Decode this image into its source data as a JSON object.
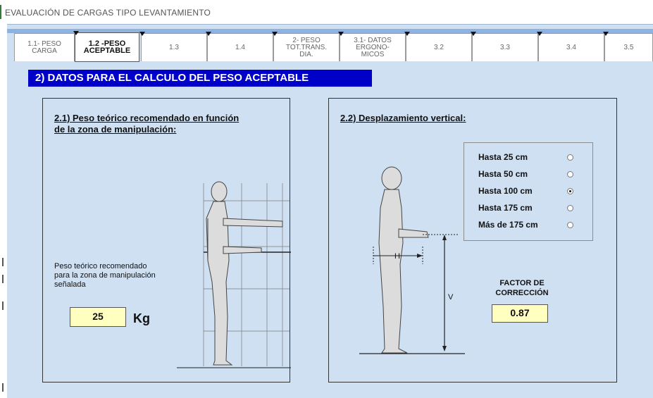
{
  "window": {
    "title": "EVALUACIÓN DE CARGAS TIPO LEVANTAMIENTO"
  },
  "tabs": [
    {
      "label": "1.1- PESO\nCARGA",
      "active": false
    },
    {
      "label": "1.2 -PESO\nACEPTABLE",
      "active": true
    },
    {
      "label": "1.3",
      "active": false
    },
    {
      "label": "1.4",
      "active": false
    },
    {
      "label": "2- PESO\nTOT.TRANS.\nDIA.",
      "active": false
    },
    {
      "label": "3.1- DATOS\nERGONO-\nMICOS",
      "active": false
    },
    {
      "label": "3.2",
      "active": false
    },
    {
      "label": "3.3",
      "active": false
    },
    {
      "label": "3.4",
      "active": false
    },
    {
      "label": "3.5",
      "active": false
    }
  ],
  "section": {
    "header": "2)  DATOS PARA EL CALCULO DEL PESO ACEPTABLE"
  },
  "panel_left": {
    "title_line1": "2.1) Peso teórico recomendado en función",
    "title_line2": "de la zona de manipulación:",
    "desc_line1": "Peso teórico recomendado",
    "desc_line2": "para la zona de manipulación",
    "desc_line3": "señalada",
    "weight_value": "25",
    "weight_unit": "Kg"
  },
  "panel_right": {
    "title": "2.2) Desplazamiento vertical:",
    "options": [
      {
        "label": "Hasta 25 cm",
        "selected": false
      },
      {
        "label": "Hasta 50 cm",
        "selected": false
      },
      {
        "label": "Hasta 100 cm",
        "selected": true
      },
      {
        "label": "Hasta 175 cm",
        "selected": false
      },
      {
        "label": "Más de 175 cm",
        "selected": false
      }
    ],
    "factor_label_line1": "FACTOR DE",
    "factor_label_line2": "CORRECCIÓN",
    "factor_value": "0.87",
    "dim_h": "H",
    "dim_v": "V"
  },
  "colors": {
    "form_bg": "#cfe0f2",
    "header_bg": "#0000c8",
    "value_bg": "#ffffc0"
  }
}
